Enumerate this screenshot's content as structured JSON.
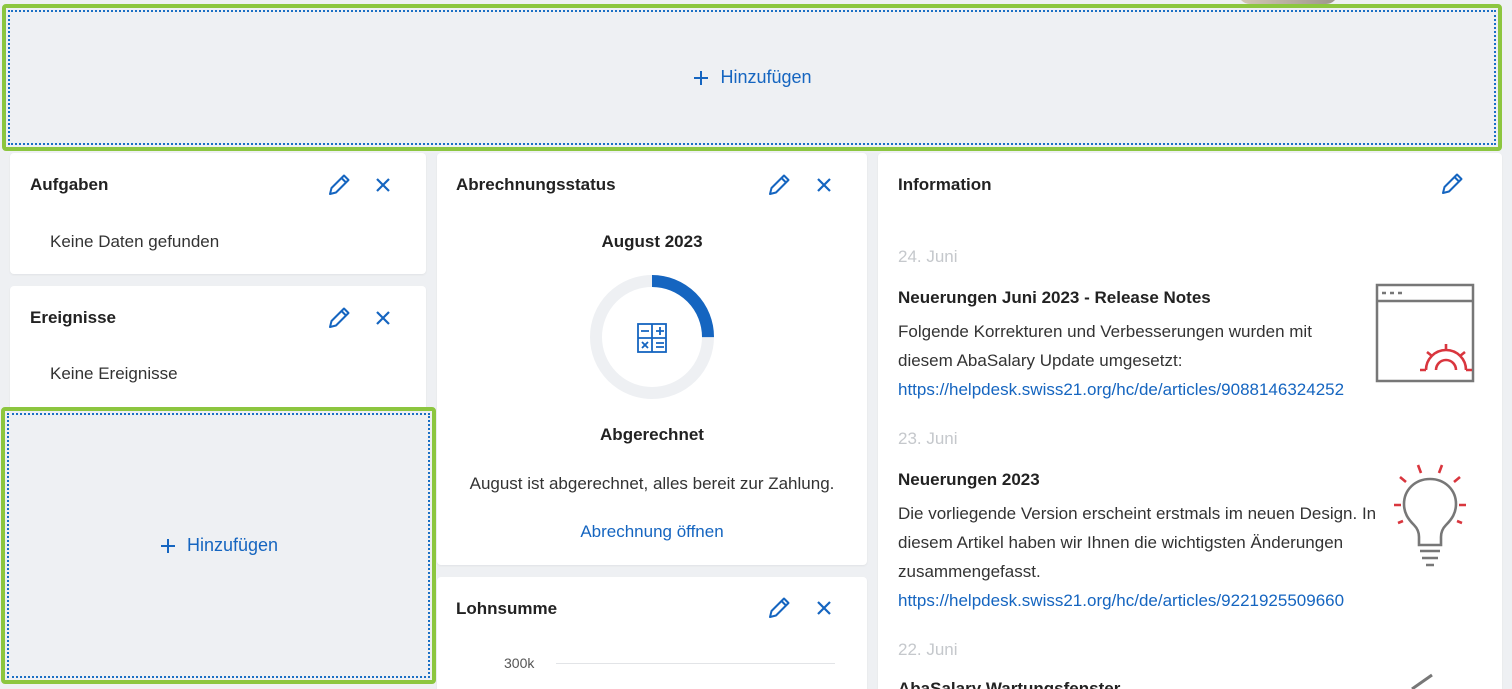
{
  "add_label": "Hinzufügen",
  "colors": {
    "accent": "#1565c0",
    "highlight": "#8cc63f",
    "danger": "#d9363e"
  },
  "aufgaben": {
    "title": "Aufgaben",
    "empty": "Keine Daten gefunden"
  },
  "ereignisse": {
    "title": "Ereignisse",
    "empty": "Keine Ereignisse"
  },
  "abrechnung": {
    "title": "Abrechnungsstatus",
    "period": "August 2023",
    "status": "Abgerechnet",
    "message": "August ist abgerechnet, alles bereit zur Zahlung.",
    "link": "Abrechnung öffnen",
    "progress": 0.25
  },
  "lohnsumme": {
    "title": "Lohnsumme",
    "y_tick": "300k"
  },
  "information": {
    "title": "Information",
    "items": [
      {
        "date": "24. Juni",
        "title": "Neuerungen Juni 2023 - Release Notes",
        "body_line1": "Folgende Korrekturen und Verbesserungen wurden mit",
        "body_line2": "diesem AbaSalary Update umgesetzt:",
        "link": "https://helpdesk.swiss21.org/hc/de/articles/9088146324252",
        "icon": "window-gear-icon"
      },
      {
        "date": "23. Juni",
        "title": "Neuerungen 2023",
        "body_line1": "Die vorliegende Version erscheint erstmals im neuen Design. In",
        "body_line2": "diesem Artikel haben wir Ihnen die wichtigsten Änderungen",
        "body_line3": "zusammengefasst.",
        "link": "https://helpdesk.swiss21.org/hc/de/articles/9221925509660",
        "icon": "lightbulb-icon"
      },
      {
        "date": "22. Juni",
        "title": "AbaSalary Wartungsfenster",
        "icon": "pencil-tip-icon"
      }
    ]
  }
}
